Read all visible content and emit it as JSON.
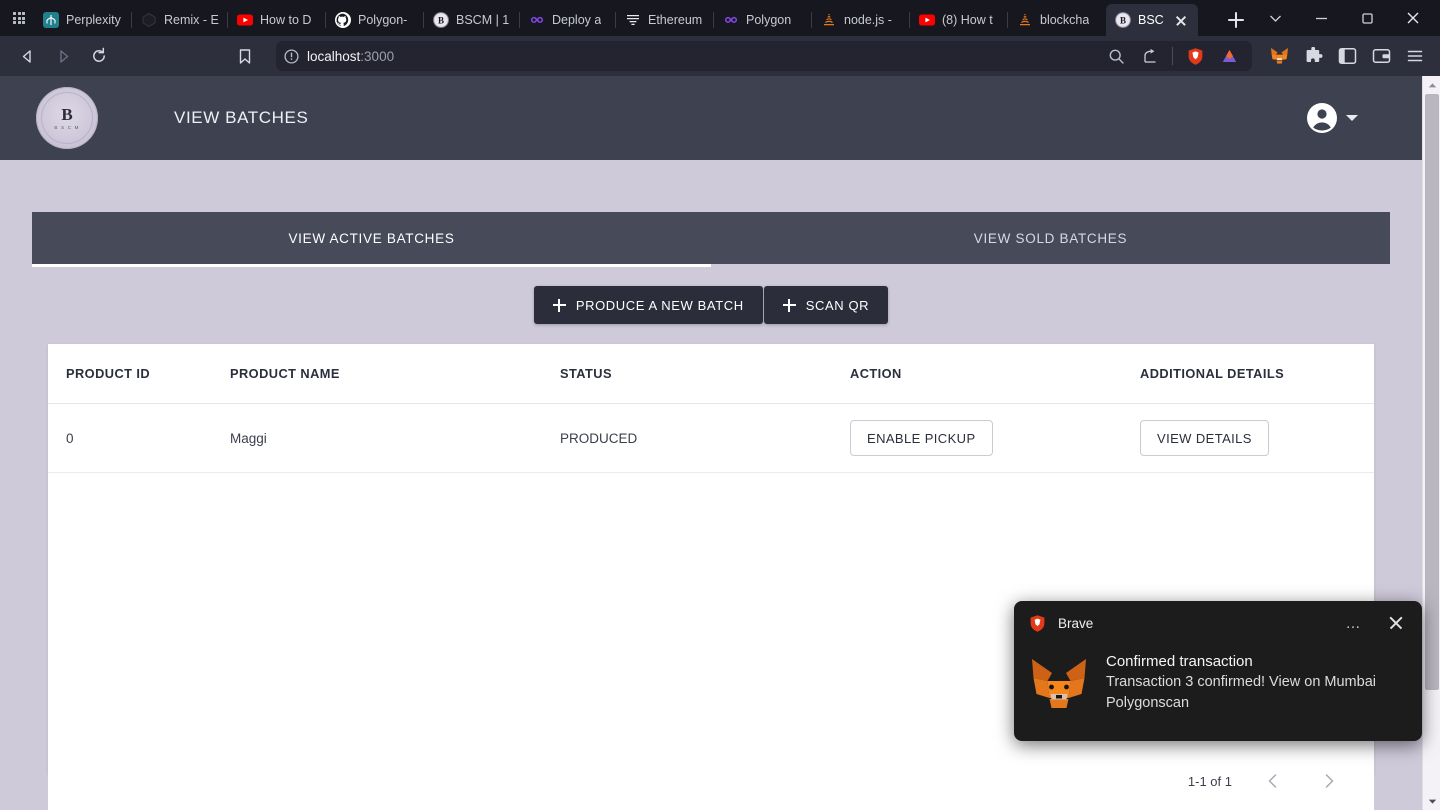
{
  "browser": {
    "tabs": [
      {
        "title": "Perplexity",
        "favicon": "perplexity-icon",
        "active": false
      },
      {
        "title": "Remix - E",
        "favicon": "remix-icon",
        "active": false
      },
      {
        "title": "How to D",
        "favicon": "youtube-icon",
        "active": false
      },
      {
        "title": "Polygon-",
        "favicon": "github-icon",
        "active": false
      },
      {
        "title": "BSCM | 1",
        "favicon": "bscm-icon",
        "active": false
      },
      {
        "title": "Deploy a",
        "favicon": "polygon-icon",
        "active": false
      },
      {
        "title": "Ethereum",
        "favicon": "ethereum-icon",
        "active": false
      },
      {
        "title": "Polygon",
        "favicon": "polygon-icon",
        "active": false
      },
      {
        "title": "node.js -",
        "favicon": "nodejs-icon",
        "active": false
      },
      {
        "title": "(8) How t",
        "favicon": "youtube-icon",
        "active": false
      },
      {
        "title": "blockcha",
        "favicon": "nodejs-icon",
        "active": false
      },
      {
        "title": "BSCM",
        "favicon": "bscm-icon",
        "active": true
      }
    ],
    "new_tab_label": "+",
    "window_controls": [
      "tab-search-chevron",
      "minimize",
      "maximize",
      "close"
    ],
    "nav": {
      "back": "back-arrow",
      "forward": "forward-arrow",
      "reload": "reload-arrow",
      "bookmark": "bookmark-icon"
    },
    "url": {
      "host": "localhost",
      "port": ":3000",
      "security": "info-icon"
    },
    "url_actions": [
      "search-icon",
      "share-icon",
      "brave-shields-icon",
      "brave-rewards-icon"
    ],
    "extensions": [
      "metamask-icon",
      "extensions-puzzle-icon",
      "sidebar-icon",
      "wallet-icon",
      "menu-hamburger-icon"
    ]
  },
  "app": {
    "logo": {
      "mark": "B",
      "sub": "B S C M"
    },
    "title": "VIEW BATCHES",
    "account_icon": "account-circle-icon",
    "tabs": [
      {
        "label": "VIEW ACTIVE BATCHES",
        "active": true
      },
      {
        "label": "VIEW SOLD BATCHES",
        "active": false
      }
    ],
    "actions": [
      {
        "label": "PRODUCE A NEW BATCH",
        "icon": "plus-icon"
      },
      {
        "label": "SCAN QR",
        "icon": "plus-icon"
      }
    ],
    "table": {
      "columns": [
        "PRODUCT ID",
        "PRODUCT NAME",
        "STATUS",
        "ACTION",
        "ADDITIONAL DETAILS"
      ],
      "rows": [
        {
          "product_id": "0",
          "product_name": "Maggi",
          "status": "PRODUCED",
          "action_label": "ENABLE PICKUP",
          "details_label": "VIEW DETAILS"
        }
      ]
    },
    "pagination": {
      "count_label": "1-1 of 1",
      "prev_icon": "chevron-left-icon",
      "next_icon": "chevron-right-icon"
    }
  },
  "notification": {
    "app_name": "Brave",
    "app_icon": "brave-lion-icon",
    "more_label": "…",
    "close_icon": "close-icon",
    "sender_icon": "metamask-fox-icon",
    "title": "Confirmed transaction",
    "message": "Transaction 3 confirmed! View on Mumbai Polygonscan"
  },
  "colors": {
    "chrome_tabstrip": "#17181f",
    "chrome_navbar": "#2d2f3d",
    "page_background": "#cfcada",
    "app_header": "#3e4150",
    "app_tabbar": "#474a59",
    "button_dark": "#2b2d3b",
    "toast_background": "#1c1c1c"
  }
}
